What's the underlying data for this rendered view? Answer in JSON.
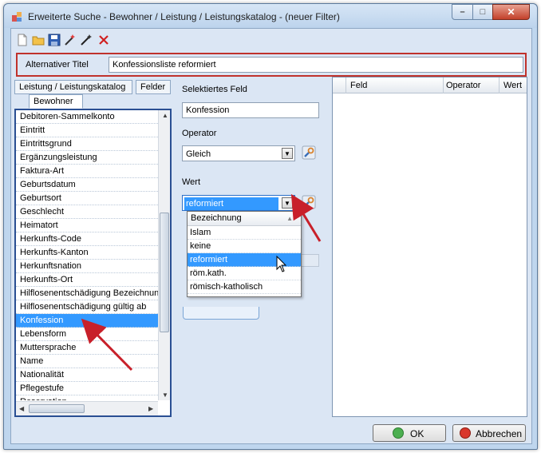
{
  "window": {
    "title": "Erweiterte Suche - Bewohner / Leistung / Leistungskatalog - (neuer Filter)",
    "controls": {
      "minimize": "–",
      "maximize": "□",
      "close": "✕"
    }
  },
  "toolbar": {
    "icons": [
      "new-document-icon",
      "open-folder-icon",
      "save-disk-icon",
      "magic-wand-icon",
      "wand-star-icon",
      "delete-x-icon"
    ]
  },
  "alt_title": {
    "label": "Alternativer Titel",
    "value": "Konfessionsliste reformiert"
  },
  "tabs": {
    "top": [
      "Leistung / Leistungskatalog",
      "Felder"
    ],
    "sub": "Bewohner"
  },
  "field_list": {
    "items": [
      "Debitoren-Sammelkonto",
      "Eintritt",
      "Eintrittsgrund",
      "Ergänzungsleistung",
      "Faktura-Art",
      "Geburtsdatum",
      "Geburtsort",
      "Geschlecht",
      "Heimatort",
      "Herkunfts-Code",
      "Herkunfts-Kanton",
      "Herkunftsnation",
      "Herkunfts-Ort",
      "Hilflosenentschädigung Bezeichnung",
      "Hilflosenentschädigung gültig ab",
      "Konfession",
      "Lebensform",
      "Muttersprache",
      "Name",
      "Nationalität",
      "Pflegestufe",
      "Reservation"
    ],
    "selected_index": 15
  },
  "selected_field": {
    "label": "Selektiertes Feld",
    "value": "Konfession"
  },
  "operator": {
    "label": "Operator",
    "value": "Gleich"
  },
  "wert": {
    "label": "Wert",
    "value": "reformiert",
    "dropdown_header": "Bezeichnung",
    "options": [
      "Islam",
      "keine",
      "reformiert",
      "röm.kath.",
      "römisch-katholisch"
    ],
    "selected_index": 2
  },
  "grid": {
    "columns": [
      "Feld",
      "Operator",
      "Wert"
    ]
  },
  "buttons": {
    "ok": "OK",
    "cancel": "Abbrechen"
  },
  "colors": {
    "selection": "#3399ff",
    "highlight_border": "#c0322c",
    "annotation_arrow": "#c8202a"
  }
}
